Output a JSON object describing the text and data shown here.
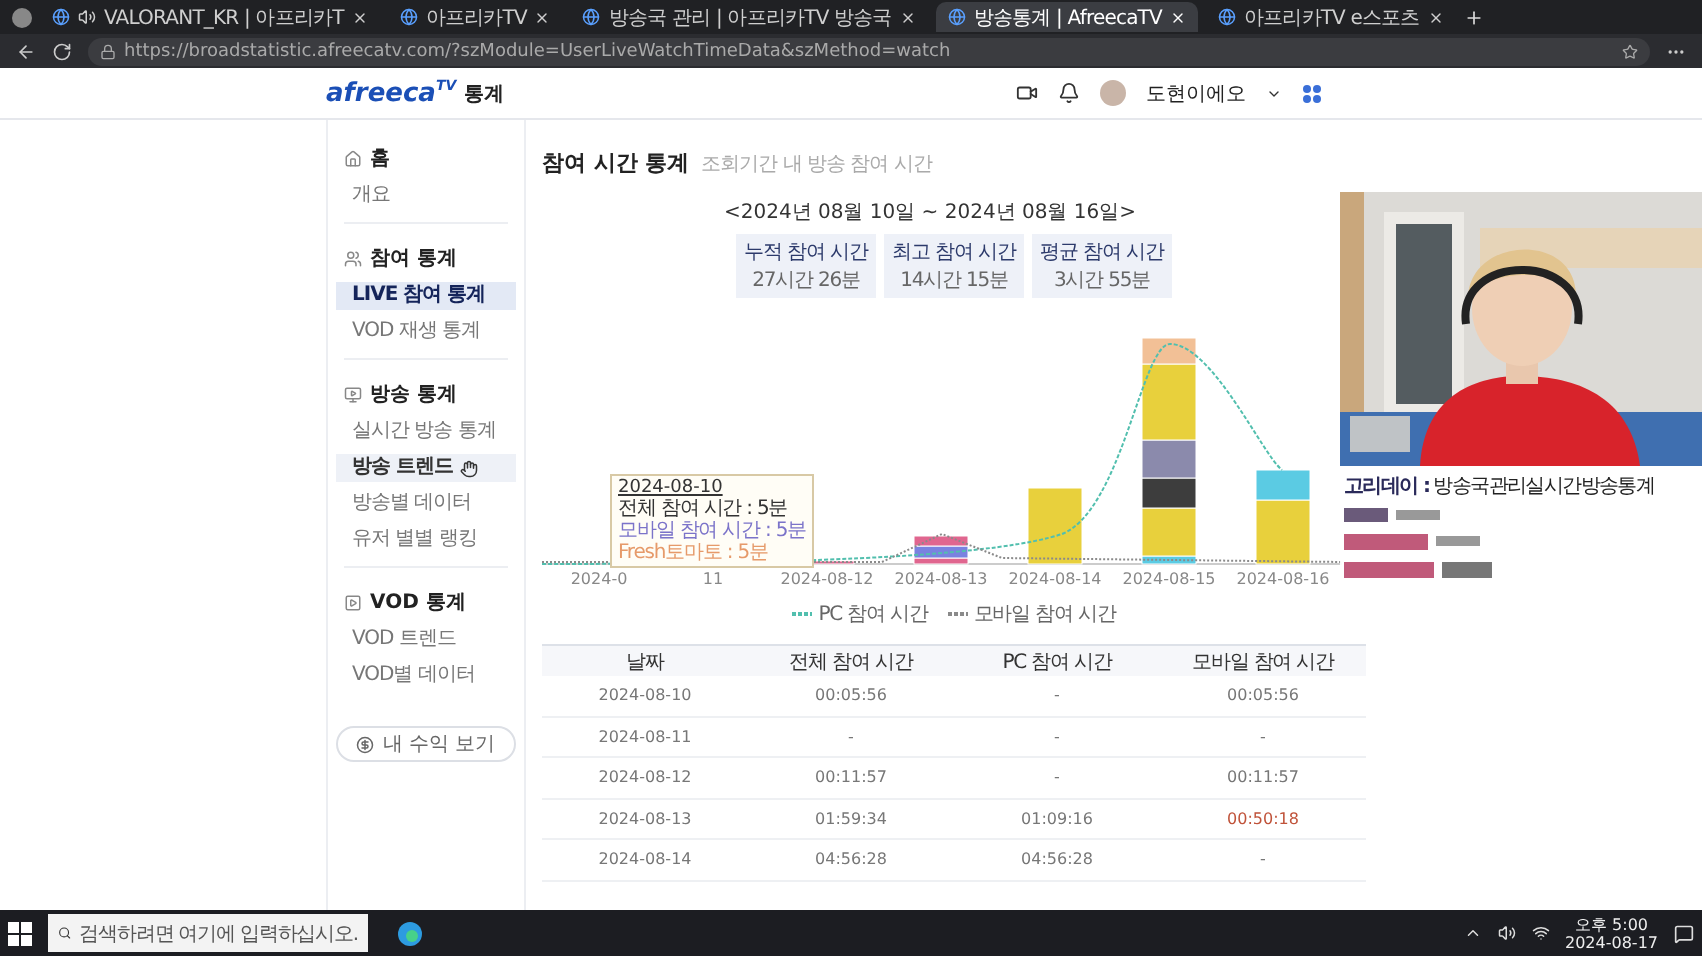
{
  "browser": {
    "tabs": [
      {
        "title": "VALORANT_KR | 아프리카T",
        "selected": false,
        "audio": true
      },
      {
        "title": "아프리카TV",
        "selected": false,
        "audio": false
      },
      {
        "title": "방송국 관리 | 아프리카TV 방송국",
        "selected": false,
        "audio": false
      },
      {
        "title": "방송통계 | AfreecaTV",
        "selected": true,
        "audio": false
      },
      {
        "title": "아프리카TV e스포츠",
        "selected": false,
        "audio": false
      }
    ],
    "url": "https://broadstatistic.afreecatv.com/?szModule=UserLiveWatchTimeData&szMethod=watch"
  },
  "header": {
    "logo": "afreeca$^{TV}$",
    "logo_suffix": "통계",
    "user": "도현이에오"
  },
  "sidebar": {
    "sections": [
      {
        "title": "홈",
        "items": [
          {
            "label": "개요",
            "selected": false,
            "hovered": false
          }
        ]
      },
      {
        "title": "참여 통계",
        "items": [
          {
            "label": "LIVE 참여 통계",
            "selected": true,
            "hovered": false
          },
          {
            "label": "VOD 재생 통계",
            "selected": false,
            "hovered": false
          }
        ]
      },
      {
        "title": "방송 통계",
        "items": [
          {
            "label": "실시간 방송 통계",
            "selected": false,
            "hovered": false
          },
          {
            "label": "방송 트렌드",
            "selected": false,
            "hovered": true
          },
          {
            "label": "방송별 데이터",
            "selected": false,
            "hovered": false
          },
          {
            "label": "유저 별별 랭킹",
            "selected": false,
            "hovered": false
          }
        ]
      },
      {
        "title": "VOD 통계",
        "items": [
          {
            "label": "VOD 트렌드",
            "selected": false,
            "hovered": false
          },
          {
            "label": "VOD별 데이터",
            "selected": false,
            "hovered": false
          }
        ]
      }
    ],
    "button": "내 수익 보기"
  },
  "main": {
    "title": "참여 시간 통계",
    "subtitle": "조회기간 내 방송 참여 시간",
    "range": "<2024년 08월 10일 ~ 2024년 08월 16일>",
    "stats": [
      {
        "label": "누적 참여 시간",
        "value": "27시간 26분"
      },
      {
        "label": "최고 참여 시간",
        "value": "14시간 15분"
      },
      {
        "label": "평균 참여 시간",
        "value": "3시간 55분"
      }
    ],
    "chart": {
      "x_labels": [
        "2024-0",
        "11",
        "2024-08-12",
        "2024-08-13",
        "2024-08-14",
        "2024-08-15",
        "2024-08-16"
      ],
      "tooltip": {
        "date": "2024-08-10",
        "lines": [
          {
            "text": "전체 참여 시간 : 5분",
            "color": "#333333"
          },
          {
            "text": "모바일 참여 시간 : 5분",
            "color": "#7b73c9"
          },
          {
            "text": "Fresh토마토 : 5분",
            "color": "#e69a6a"
          }
        ]
      },
      "legend": [
        {
          "label": "PC 참여 시간",
          "color": "#52bfae"
        },
        {
          "label": "모바일 참여 시간",
          "color": "#8a8a8a"
        }
      ]
    },
    "table": {
      "columns": [
        "날짜",
        "전체 참여 시간",
        "PC 참여 시간",
        "모바일 참여 시간"
      ],
      "rows": [
        {
          "cells": [
            {
              "text": "2024-08-10",
              "accent": false
            },
            {
              "text": "00:05:56",
              "accent": false
            },
            {
              "text": "-",
              "accent": false
            },
            {
              "text": "00:05:56",
              "accent": false
            }
          ]
        },
        {
          "cells": [
            {
              "text": "2024-08-11",
              "accent": false
            },
            {
              "text": "-",
              "accent": false
            },
            {
              "text": "-",
              "accent": false
            },
            {
              "text": "-",
              "accent": false
            }
          ]
        },
        {
          "cells": [
            {
              "text": "2024-08-12",
              "accent": false
            },
            {
              "text": "00:11:57",
              "accent": false
            },
            {
              "text": "-",
              "accent": false
            },
            {
              "text": "00:11:57",
              "accent": false
            }
          ]
        },
        {
          "cells": [
            {
              "text": "2024-08-13",
              "accent": false
            },
            {
              "text": "01:59:34",
              "accent": false
            },
            {
              "text": "01:09:16",
              "accent": false
            },
            {
              "text": "00:50:18",
              "accent": true
            }
          ]
        },
        {
          "cells": [
            {
              "text": "2024-08-14",
              "accent": false
            },
            {
              "text": "04:56:28",
              "accent": false
            },
            {
              "text": "04:56:28",
              "accent": false
            },
            {
              "text": "-",
              "accent": false
            }
          ]
        }
      ]
    }
  },
  "stream_overlay": {
    "kind": "picture",
    "chat": [
      {
        "name": "고리데이 :",
        "message": "방송국관리실시간방송통계"
      }
    ]
  },
  "taskbar": {
    "search_placeholder": "검색하려면 여기에 입력하십시오.",
    "time": "오후 5:00",
    "date": "2024-08-17"
  }
}
